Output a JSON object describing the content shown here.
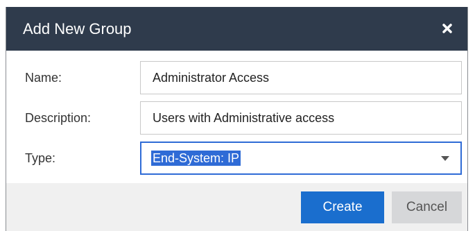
{
  "dialog": {
    "title": "Add New Group",
    "close_icon": "close-icon"
  },
  "form": {
    "name": {
      "label": "Name:",
      "value": "Administrator Access"
    },
    "description": {
      "label": "Description:",
      "value": "Users with Administrative access"
    },
    "type": {
      "label": "Type:",
      "selected": "End-System: IP"
    }
  },
  "buttons": {
    "create": "Create",
    "cancel": "Cancel"
  },
  "colors": {
    "titlebar": "#2f3b4c",
    "accent": "#1a6ece",
    "cancel_bg": "#d6d7d9",
    "footer_bg": "#f0f0f0"
  }
}
